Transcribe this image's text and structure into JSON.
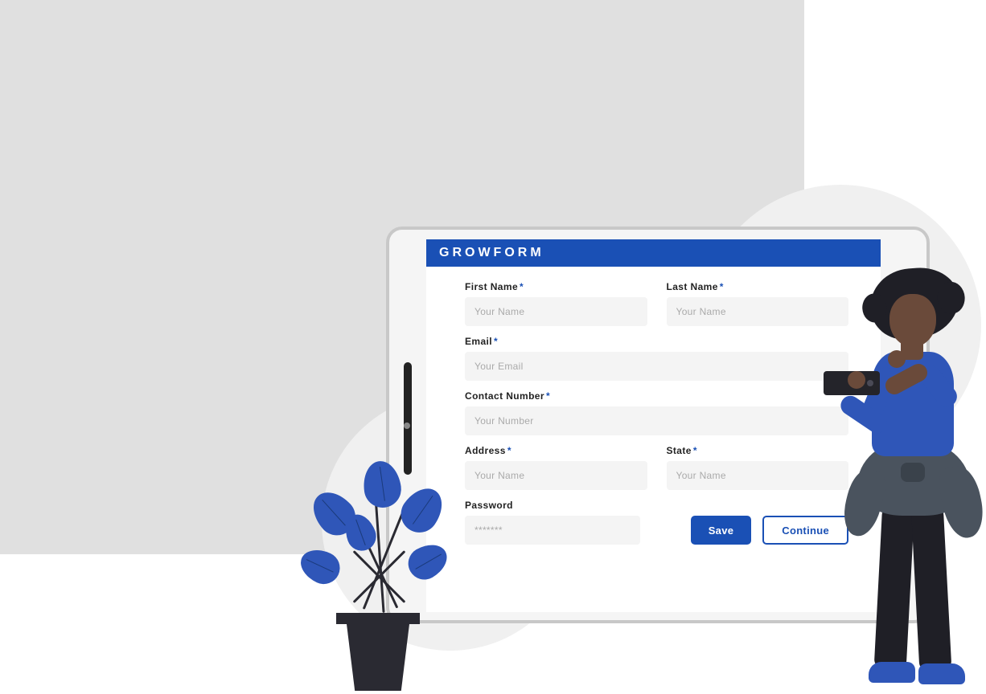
{
  "header": {
    "title": "GROWFORM"
  },
  "form": {
    "firstName": {
      "label": "First Name",
      "required": "*",
      "placeholder": "Your Name"
    },
    "lastName": {
      "label": "Last Name",
      "required": "*",
      "placeholder": "Your Name"
    },
    "email": {
      "label": "Email",
      "required": "*",
      "placeholder": "Your Email"
    },
    "contact": {
      "label": "Contact  Number",
      "required": "*",
      "placeholder": "Your Number"
    },
    "address": {
      "label": "Address",
      "required": "*",
      "placeholder": "Your Name"
    },
    "state": {
      "label": "State",
      "required": "*",
      "placeholder": "Your Name"
    },
    "password": {
      "label": "Password",
      "placeholder": "*******"
    }
  },
  "buttons": {
    "save": "Save",
    "continue": "Continue"
  },
  "colors": {
    "brand": "#1a50b5"
  }
}
